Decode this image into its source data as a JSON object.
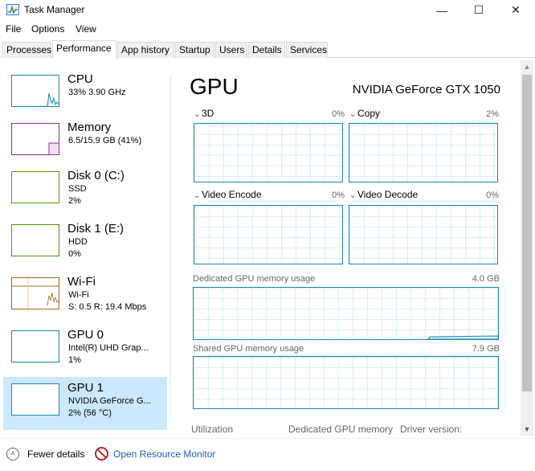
{
  "window": {
    "title": "Task Manager",
    "minimize_glyph": "—",
    "maximize_glyph": "☐",
    "close_glyph": "✕"
  },
  "menu": [
    "File",
    "Options",
    "View"
  ],
  "tabs": [
    "Processes",
    "Performance",
    "App history",
    "Startup",
    "Users",
    "Details",
    "Services"
  ],
  "active_tab": "Performance",
  "sidebar": {
    "items": [
      {
        "title": "CPU",
        "line1": "33%  3.90 GHz",
        "line2": "",
        "color": "#1b88b4",
        "level": 0.33
      },
      {
        "title": "Memory",
        "line1": "6.5/15.9 GB (41%)",
        "line2": "",
        "color": "#8b2f9c",
        "level": 0.41
      },
      {
        "title": "Disk 0 (C:)",
        "line1": "SSD",
        "line2": "2%",
        "color": "#4d9a06",
        "level": 0.02
      },
      {
        "title": "Disk 1 (E:)",
        "line1": "HDD",
        "line2": "0%",
        "color": "#4d9a06",
        "level": 0
      },
      {
        "title": "Wi-Fi",
        "line1": "Wi-Fi",
        "line2": "S: 0.5  R: 19.4 Mbps",
        "color": "#a7641b",
        "level": 0.5
      },
      {
        "title": "GPU 0",
        "line1": "Intel(R) UHD Grap...",
        "line2": "1%",
        "color": "#1b88b4",
        "level": 0.01
      },
      {
        "title": "GPU 1",
        "line1": "NVIDIA GeForce G...",
        "line2": "2%  (56 °C)",
        "color": "#1b88b4",
        "level": 0.02
      }
    ],
    "selected_index": 6
  },
  "main": {
    "title": "GPU",
    "model": "NVIDIA GeForce GTX 1050",
    "engines": [
      {
        "label": "3D",
        "pct": "0%"
      },
      {
        "label": "Copy",
        "pct": "2%"
      },
      {
        "label": "Video Encode",
        "pct": "0%"
      },
      {
        "label": "Video Decode",
        "pct": "0%"
      }
    ],
    "dedicated_label": "Dedicated GPU memory usage",
    "dedicated_max": "4.0 GB",
    "shared_label": "Shared GPU memory usage",
    "shared_max": "7.9 GB",
    "bottom_labels": [
      "Utilization",
      "Dedicated GPU memory",
      "Driver version:"
    ]
  },
  "footer": {
    "fewer_details": "Fewer details",
    "resource_monitor": "Open Resource Monitor"
  },
  "colors": {
    "accent": "#1b88b4",
    "selected_bg": "#cce8ff",
    "link": "#1a5fb4"
  }
}
